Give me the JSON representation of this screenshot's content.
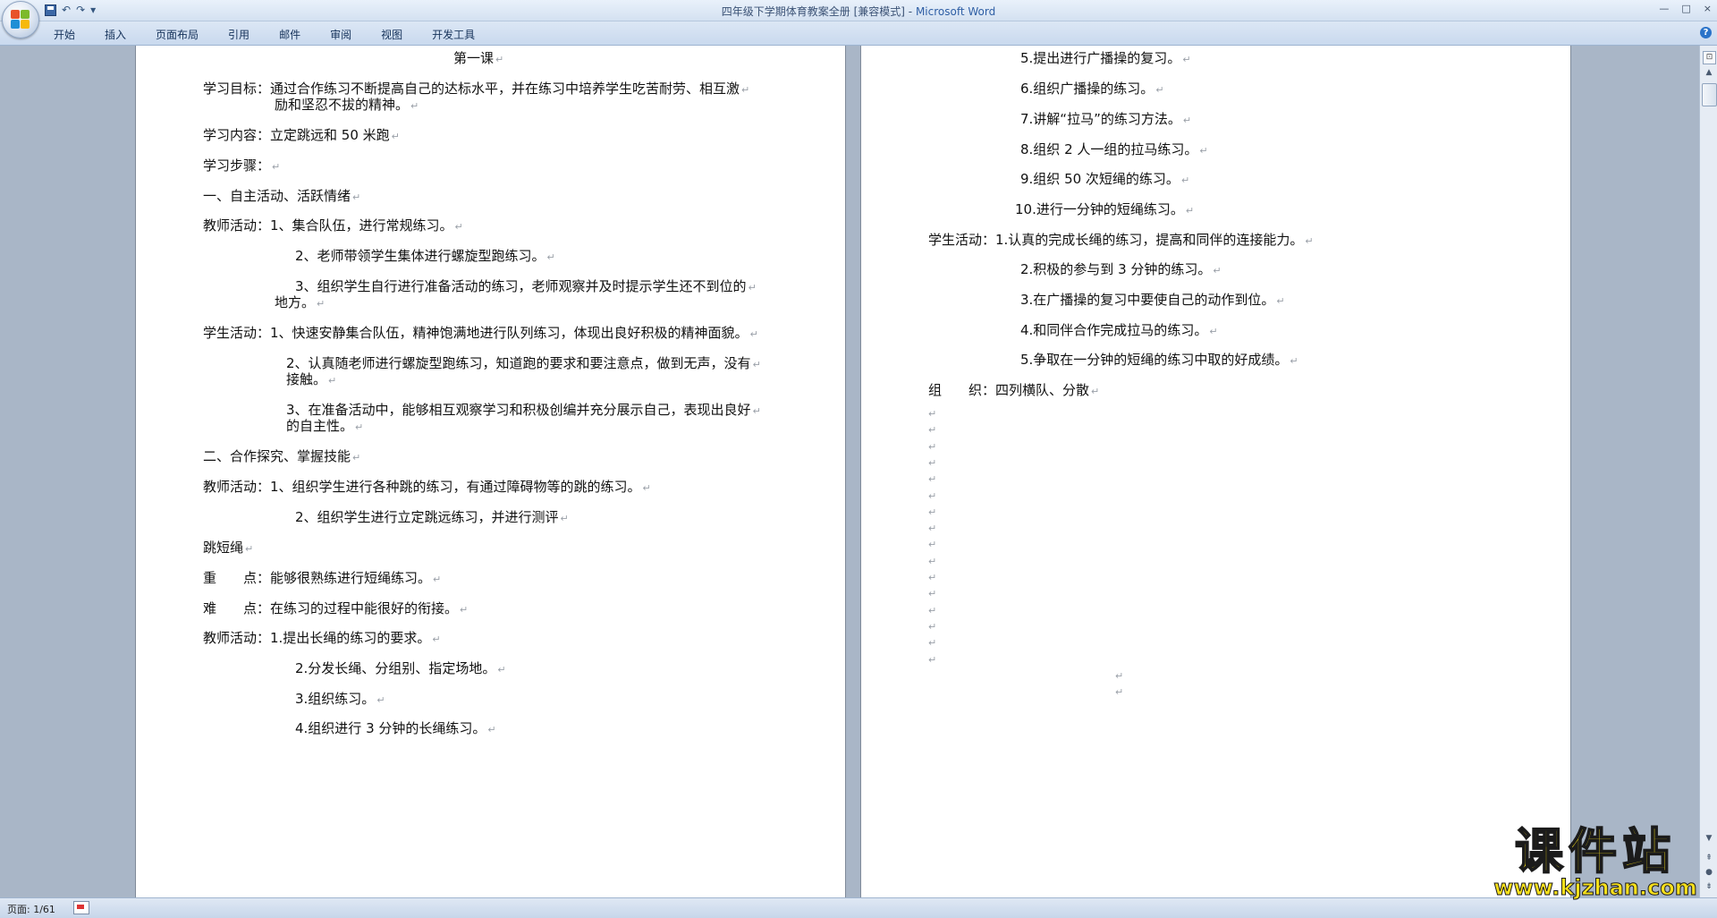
{
  "window": {
    "title": "四年级下学期体育教案全册 [兼容模式]",
    "app_name": "Microsoft Word",
    "controls": [
      "—",
      "□",
      "×"
    ]
  },
  "quick_access": {
    "undo": "↶",
    "redo": "↷",
    "customize": "▾"
  },
  "ribbon": {
    "tabs": [
      "开始",
      "插入",
      "页面布局",
      "引用",
      "邮件",
      "审阅",
      "视图",
      "开发工具"
    ]
  },
  "paragraph_mark": "↵",
  "page1": {
    "lines": [
      {
        "text": "第一课"
      },
      {
        "text": "学习目标：通过合作练习不断提高自己的达标水平，并在练习中培养学生吃苦耐劳、相互激"
      },
      {
        "text": "励和坚忍不拔的精神。"
      },
      {
        "text": "学习内容：立定跳远和 50 米跑"
      },
      {
        "text": "学习步骤："
      },
      {
        "text": "一、自主活动、活跃情绪"
      },
      {
        "text": "教师活动：1、集合队伍，进行常规练习。"
      },
      {
        "text": "2、老师带领学生集体进行螺旋型跑练习。"
      },
      {
        "text": "3、组织学生自行进行准备活动的练习，老师观察并及时提示学生还不到位的"
      },
      {
        "text": "地方。"
      },
      {
        "text": "学生活动：1、快速安静集合队伍，精神饱满地进行队列练习，体现出良好积极的精神面貌。"
      },
      {
        "text": "2、认真随老师进行螺旋型跑练习，知道跑的要求和要注意点，做到无声，没有"
      },
      {
        "text": "接触。"
      },
      {
        "text": "3、在准备活动中，能够相互观察学习和积极创编并充分展示自己，表现出良好"
      },
      {
        "text": "的自主性。"
      },
      {
        "text": "二、合作探究、掌握技能"
      },
      {
        "text": "教师活动：1、组织学生进行各种跳的练习，有通过障碍物等的跳的练习。"
      },
      {
        "text": "2、组织学生进行立定跳远练习，并进行测评"
      },
      {
        "text": "跳短绳"
      },
      {
        "text": "重　　点：能够很熟练进行短绳练习。"
      },
      {
        "text": "难　　点：在练习的过程中能很好的衔接。"
      },
      {
        "text": "教师活动：1.提出长绳的练习的要求。"
      },
      {
        "text": "2.分发长绳、分组别、指定场地。"
      },
      {
        "text": "3.组织练习。"
      },
      {
        "text": "4.组织进行 3 分钟的长绳练习。"
      }
    ]
  },
  "page2": {
    "lines": [
      {
        "text": "5.提出进行广播操的复习。"
      },
      {
        "text": "6.组织广播操的练习。"
      },
      {
        "text": "7.讲解“拉马”的练习方法。"
      },
      {
        "text": "8.组织 2 人一组的拉马练习。"
      },
      {
        "text": "9.组织 50 次短绳的练习。"
      },
      {
        "text": "10.进行一分钟的短绳练习。"
      },
      {
        "text": "学生活动：1.认真的完成长绳的练习，提高和同伴的连接能力。"
      },
      {
        "text": "2.积极的参与到 3 分钟的练习。"
      },
      {
        "text": "3.在广播操的复习中要使自己的动作到位。"
      },
      {
        "text": "4.和同伴合作完成拉马的练习。"
      },
      {
        "text": "5.争取在一分钟的短绳的练习中取的好成绩。"
      },
      {
        "text": "组　　织：四列横队、分散"
      }
    ],
    "empty_paragraphs": 18
  },
  "status": {
    "page_indicator": "页面: 1/61"
  },
  "watermark": {
    "brand": "课件站",
    "url": "www.kjzhan.com"
  },
  "colors": {
    "ribbon_bg": "#d4e1f1",
    "app_bg": "#a9b6c7",
    "watermark_fill": "#f7e01b"
  }
}
